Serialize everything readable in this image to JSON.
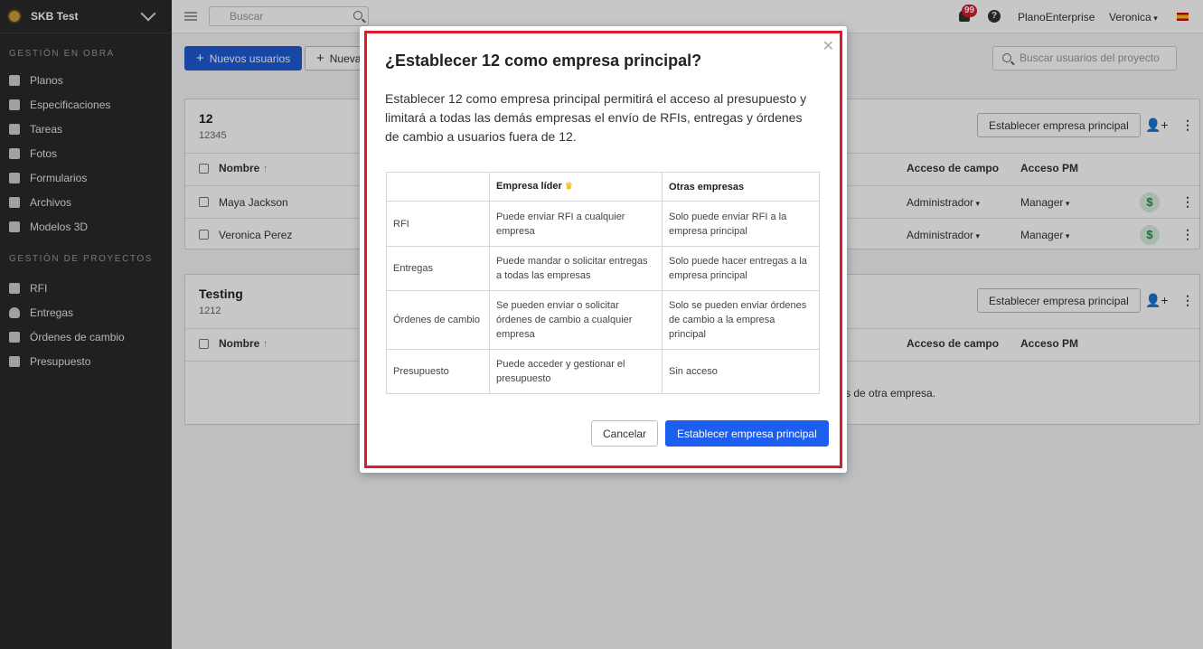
{
  "sidebar": {
    "project": "SKB Test",
    "section1": "GESTIÓN EN OBRA",
    "items1": [
      "Planos",
      "Especificaciones",
      "Tareas",
      "Fotos",
      "Formularios",
      "Archivos",
      "Modelos 3D"
    ],
    "section2": "GESTIÓN DE PROYECTOS",
    "items2": [
      "RFI",
      "Entregas",
      "Órdenes de cambio",
      "Presupuesto"
    ]
  },
  "topbar": {
    "search_placeholder": "Buscar",
    "notifications": "99",
    "help": "?",
    "company": "PlanoEnterprise",
    "user": "Veronica"
  },
  "toolbar": {
    "new_users": "Nuevos usuarios",
    "new_other": "Nueva",
    "search_users_placeholder": "Buscar usuarios del proyecto"
  },
  "cards": [
    {
      "title": "12",
      "subtitle": "12345",
      "set_principal": "Establecer empresa principal",
      "col_name": "Nombre",
      "col_field": "Acceso de campo",
      "col_pm": "Acceso PM",
      "rows": [
        {
          "name": "Maya Jackson",
          "field": "Administrador",
          "pm": "Manager"
        },
        {
          "name": "Veronica Perez",
          "field": "Administrador",
          "pm": "Manager"
        }
      ]
    },
    {
      "title": "Testing",
      "subtitle": "1212",
      "set_principal": "Establecer empresa principal",
      "col_name": "Nombre",
      "col_field": "Acceso de campo",
      "col_pm": "Acceso PM",
      "empty_fragment": "tes de otra empresa."
    }
  ],
  "modal": {
    "title": "¿Establecer 12 como empresa principal?",
    "description": "Establecer 12 como empresa principal permitirá el acceso al presupuesto y limitará a todas las demás empresas el envío de RFIs, entregas y órdenes de cambio a usuarios fuera de 12.",
    "table": {
      "headers": [
        "",
        "Empresa líder",
        "Otras empresas"
      ],
      "rows": [
        {
          "label": "RFI",
          "lead": "Puede enviar RFI a cualquier empresa",
          "other": "Solo puede enviar RFI a la empresa principal"
        },
        {
          "label": "Entregas",
          "lead": "Puede mandar o solicitar entregas a todas las empresas",
          "other": "Solo puede hacer entregas a la empresa principal"
        },
        {
          "label": "Órdenes de cambio",
          "lead": "Se pueden enviar o solicitar órdenes de cambio a cualquier empresa",
          "other": "Solo se pueden enviar órdenes de cambio a la empresa principal"
        },
        {
          "label": "Presupuesto",
          "lead": "Puede acceder y gestionar el presupuesto",
          "other": "Sin acceso"
        }
      ]
    },
    "cancel": "Cancelar",
    "confirm": "Establecer empresa principal"
  }
}
